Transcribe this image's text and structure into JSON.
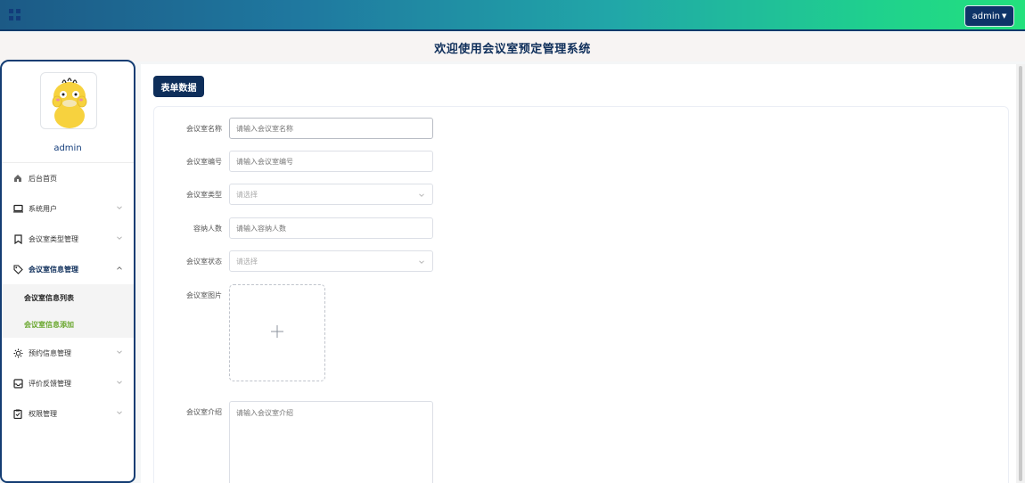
{
  "header": {
    "user_button_label": "admin",
    "title": "欢迎使用会议室预定管理系统"
  },
  "sidebar": {
    "username": "admin",
    "items": [
      {
        "label": "后台首页",
        "icon": "home-icon"
      },
      {
        "label": "系统用户",
        "icon": "monitor-icon"
      },
      {
        "label": "会议室类型管理",
        "icon": "bookmark-icon"
      },
      {
        "label": "会议室信息管理",
        "icon": "tag-icon",
        "active": true,
        "children": [
          {
            "label": "会议室信息列表"
          },
          {
            "label": "会议室信息添加",
            "selected": true
          }
        ]
      },
      {
        "label": "预约信息管理",
        "icon": "sun-icon"
      },
      {
        "label": "评价反馈管理",
        "icon": "inbox-icon"
      },
      {
        "label": "权限管理",
        "icon": "clipboard-icon"
      }
    ]
  },
  "main": {
    "tag": "表单数据",
    "form": {
      "name": {
        "label": "会议室名称",
        "placeholder": "请输入会议室名称",
        "value": ""
      },
      "code": {
        "label": "会议室编号",
        "placeholder": "请输入会议室编号",
        "value": ""
      },
      "type": {
        "label": "会议室类型",
        "placeholder": "请选择"
      },
      "capacity": {
        "label": "容纳人数",
        "placeholder": "请输入容纳人数",
        "value": ""
      },
      "status": {
        "label": "会议室状态",
        "placeholder": "请选择"
      },
      "image": {
        "label": "会议室图片"
      },
      "intro": {
        "label": "会议室介绍",
        "placeholder": "请输入会议室介绍"
      }
    }
  },
  "colors": {
    "navy": "#0e2e5a",
    "accent_green": "#6aa72f",
    "topbar_gradient": [
      "#1c5a86",
      "#21a7a8",
      "#23e17d"
    ]
  }
}
